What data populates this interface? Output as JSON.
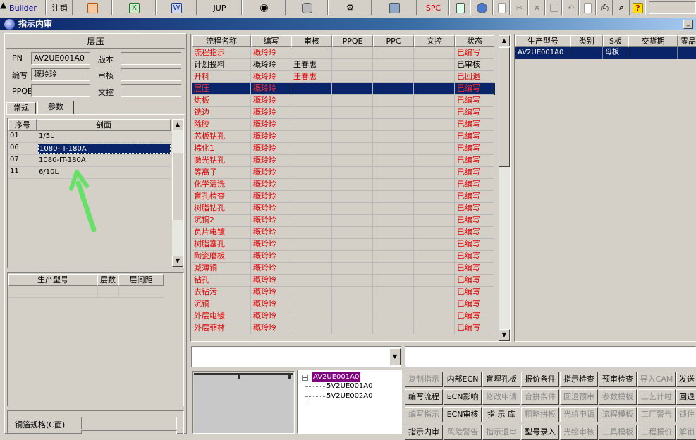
{
  "toolbar": {
    "builder": "Builder",
    "logout": "注销",
    "jup": "JUP",
    "spc": "SPC"
  },
  "window": {
    "title": "指示内审",
    "min": "_"
  },
  "left": {
    "section_title": "层压",
    "pn_label": "PN",
    "pn_value": "AV2UE001A0",
    "version_label": "版本",
    "version_value": "",
    "author_label": "编写",
    "author_value": "穊玲玲",
    "review_label": "审核",
    "review_value": "",
    "ppqe_label": "PPQE",
    "ppqe_value": "",
    "doc_label": "文控",
    "doc_value": "",
    "tabs": [
      "常规",
      "参数"
    ],
    "stack_headers": [
      "序号",
      "剖面"
    ],
    "stack_rows": [
      {
        "no": "01",
        "section": "1/5L"
      },
      {
        "no": "06",
        "section": "1080-IT-180A"
      },
      {
        "no": "07",
        "section": "1080-IT-180A"
      },
      {
        "no": "11",
        "section": "6/10L"
      }
    ],
    "stack_selected": 1,
    "model_headers": [
      "生产型号",
      "层数",
      "层间距"
    ],
    "copper_label": "铜箔规格(C面)"
  },
  "flow": {
    "headers": [
      "流程名称",
      "编写",
      "审核",
      "PPQE",
      "PPC",
      "文控",
      "状态"
    ],
    "rows": [
      {
        "name": "流程指示",
        "author": "穊玲玲",
        "reviewer": "",
        "status": "已编写",
        "red": true
      },
      {
        "name": "计划投料",
        "author": "穊玲玲",
        "reviewer": "王春惠",
        "status": "已审核",
        "red": false
      },
      {
        "name": "开料",
        "author": "穊玲玲",
        "reviewer": "王春惠",
        "status": "已回退",
        "red": true
      },
      {
        "name": "层压",
        "author": "穊玲玲",
        "reviewer": "",
        "status": "已编写",
        "red": true
      },
      {
        "name": "烘板",
        "author": "穊玲玲",
        "reviewer": "",
        "status": "已编写",
        "red": true
      },
      {
        "name": "铣边",
        "author": "穊玲玲",
        "reviewer": "",
        "status": "已编写",
        "red": true
      },
      {
        "name": "除胶",
        "author": "穊玲玲",
        "reviewer": "",
        "status": "已编写",
        "red": true
      },
      {
        "name": "芯板钻孔",
        "author": "穊玲玲",
        "reviewer": "",
        "status": "已编写",
        "red": true
      },
      {
        "name": "棕化1",
        "author": "穊玲玲",
        "reviewer": "",
        "status": "已编写",
        "red": true
      },
      {
        "name": "激光钻孔",
        "author": "穊玲玲",
        "reviewer": "",
        "status": "已编写",
        "red": true
      },
      {
        "name": "等离子",
        "author": "穊玲玲",
        "reviewer": "",
        "status": "已编写",
        "red": true
      },
      {
        "name": "化学清洗",
        "author": "穊玲玲",
        "reviewer": "",
        "status": "已编写",
        "red": true
      },
      {
        "name": "盲孔检查",
        "author": "穊玲玲",
        "reviewer": "",
        "status": "已编写",
        "red": true
      },
      {
        "name": "树脂钻孔",
        "author": "穊玲玲",
        "reviewer": "",
        "status": "已编写",
        "red": true
      },
      {
        "name": "沉铜2",
        "author": "穊玲玲",
        "reviewer": "",
        "status": "已编写",
        "red": true
      },
      {
        "name": "负片电镀",
        "author": "穊玲玲",
        "reviewer": "",
        "status": "已编写",
        "red": true
      },
      {
        "name": "树脂塞孔",
        "author": "穊玲玲",
        "reviewer": "",
        "status": "已编写",
        "red": true
      },
      {
        "name": "陶瓷磨板",
        "author": "穊玲玲",
        "reviewer": "",
        "status": "已编写",
        "red": true
      },
      {
        "name": "减薄铜",
        "author": "穊玲玲",
        "reviewer": "",
        "status": "已编写",
        "red": true
      },
      {
        "name": "钻孔",
        "author": "穊玲玲",
        "reviewer": "",
        "status": "已编写",
        "red": true
      },
      {
        "name": "去钻污",
        "author": "穊玲玲",
        "reviewer": "",
        "status": "已编写",
        "red": true
      },
      {
        "name": "沉铜",
        "author": "穊玲玲",
        "reviewer": "",
        "status": "已编写",
        "red": true
      },
      {
        "name": "外层电镀",
        "author": "穊玲玲",
        "reviewer": "",
        "status": "已编写",
        "red": true
      },
      {
        "name": "外层菲林",
        "author": "穊玲玲",
        "reviewer": "",
        "status": "已编写",
        "red": true
      }
    ],
    "selected": 3
  },
  "right": {
    "headers": [
      "生产型号",
      "类别",
      "S板",
      "交货期",
      "零品"
    ],
    "rows": [
      {
        "model": "AV2UE001A0",
        "type": "",
        "sboard": "母板",
        "delivery": "",
        "part": ""
      }
    ]
  },
  "tree": {
    "root": "AV2UE001A0",
    "children": [
      "5V2UE001A0",
      "5V2UE002A0"
    ]
  },
  "actions": [
    [
      "复制指示",
      "内部ECN",
      "盲埋孔板",
      "报价条件",
      "指示检查",
      "预审检查",
      "导入CAM",
      "发送"
    ],
    [
      "编写流程",
      "ECN影响",
      "修改申请",
      "合拼条件",
      "回退预审",
      "参数模板",
      "工艺计时",
      "回退"
    ],
    [
      "编写指示",
      "ECN审核",
      "指 示 库",
      "粗略拼板",
      "光绘申请",
      "流程模板",
      "工厂警告",
      "锁住"
    ],
    [
      "指示内审",
      "风险警告",
      "指示退审",
      "型号录入",
      "光绘审核",
      "工具模板",
      "工程报价",
      "解锁"
    ]
  ],
  "actions_disabled": [
    [
      true,
      false,
      false,
      false,
      false,
      false,
      true,
      false
    ],
    [
      false,
      false,
      true,
      true,
      true,
      true,
      true,
      false
    ],
    [
      true,
      false,
      false,
      true,
      true,
      true,
      true,
      true
    ],
    [
      false,
      true,
      true,
      false,
      true,
      true,
      true,
      true
    ]
  ]
}
